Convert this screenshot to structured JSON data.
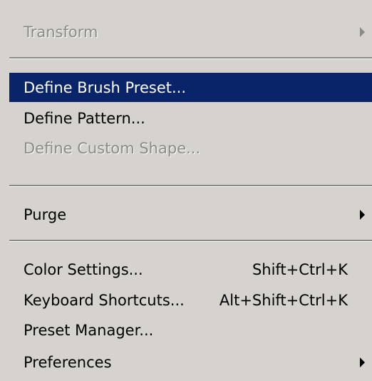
{
  "menu": {
    "items": [
      {
        "label": "Transform",
        "shortcut": "",
        "submenu": true,
        "disabled": true
      },
      {
        "label": "Define Brush Preset...",
        "shortcut": "",
        "highlighted": true
      },
      {
        "label": "Define Pattern...",
        "shortcut": ""
      },
      {
        "label": "Define Custom Shape...",
        "shortcut": "",
        "disabled": true
      },
      {
        "label": "Purge",
        "shortcut": "",
        "submenu": true
      },
      {
        "label": "Color Settings...",
        "shortcut": "Shift+Ctrl+K"
      },
      {
        "label": "Keyboard Shortcuts...",
        "shortcut": "Alt+Shift+Ctrl+K"
      },
      {
        "label": "Preset Manager...",
        "shortcut": ""
      },
      {
        "label": "Preferences",
        "shortcut": "",
        "submenu": true
      }
    ]
  },
  "colors": {
    "menu_bg": "#d6d3ce",
    "highlight_bg": "#0a246a",
    "highlight_text": "#ffffff",
    "disabled_text": "#8c8a85"
  }
}
